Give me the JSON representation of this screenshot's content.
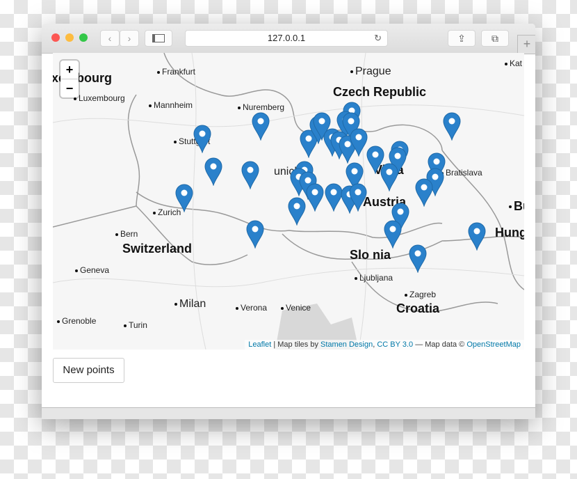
{
  "browser": {
    "url": "127.0.0.1",
    "colors": {
      "close": "#fc5753",
      "minimize": "#fdbc40",
      "zoom": "#33c748"
    }
  },
  "map": {
    "zoom_in": "+",
    "zoom_out": "−",
    "labels": {
      "luxembourg_region": "xembourg",
      "frankfurt": "Frankfurt",
      "luxembourg": "Luxembourg",
      "mannheim": "Mannheim",
      "nuremberg": "Nuremberg",
      "prague": "Prague",
      "czech": "Czech Republic",
      "kat": "Kat",
      "stuttgart": "Stuttgart",
      "munich": "unich",
      "vienna": "Vi   na",
      "bratislava": "Bratislava",
      "austria": "Austria",
      "zurich": "Zurich",
      "bern": "Bern",
      "switzerland": "Switzerland",
      "bu": "Bu",
      "hung": "Hung",
      "geneva": "Geneva",
      "slovenia": "Slo     nia",
      "ljubljana": "Ljubljana",
      "zagreb": "Zagreb",
      "croatia": "Croatia",
      "milan": "Milan",
      "verona": "Verona",
      "venice": "Venice",
      "grenoble": "Grenoble",
      "turin": "Turin"
    },
    "marker_color": "#2a81cb",
    "attribution": {
      "leaflet": "Leaflet",
      "sep1": " | Map tiles by ",
      "stamen": "Stamen Design",
      "comma": ", ",
      "cc": "CC BY 3.0",
      "sep2": " — Map data © ",
      "osm": "OpenStreetMap"
    }
  },
  "new_points_label": "New points"
}
